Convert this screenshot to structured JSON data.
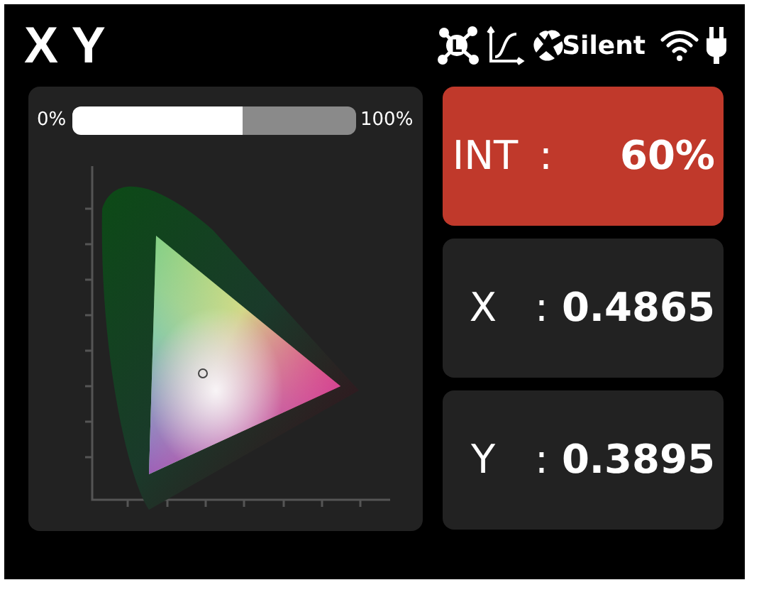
{
  "title": "X Y",
  "status": {
    "network_badge": "L",
    "fan_mode": "Silent"
  },
  "intensity": {
    "min_label": "0%",
    "max_label": "100%",
    "level": 0.6
  },
  "readings": [
    {
      "label": "INT",
      "separator": ":",
      "value": "60%",
      "selected": true
    },
    {
      "label": "X",
      "separator": ":",
      "value": "0.4865",
      "selected": false
    },
    {
      "label": "Y",
      "separator": ":",
      "value": "0.3895",
      "selected": false
    }
  ]
}
